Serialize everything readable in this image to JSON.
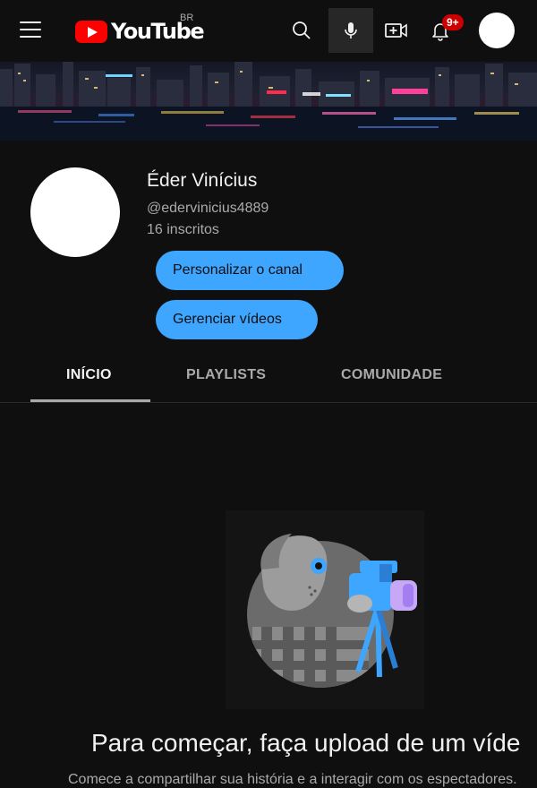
{
  "header": {
    "logo_text": "YouTube",
    "region": "BR",
    "notifications_badge": "9+",
    "icons": [
      "menu-icon",
      "search-icon",
      "mic-icon",
      "create-video-icon",
      "bell-icon"
    ]
  },
  "channel": {
    "name": "Éder Vinícius",
    "handle": "@edervinicius4889",
    "subscribers": "16 inscritos",
    "customize_label": "Personalizar o canal",
    "manage_label": "Gerenciar vídeos"
  },
  "tabs": [
    {
      "label": "INÍCIO",
      "active": true
    },
    {
      "label": "PLAYLISTS",
      "active": false
    },
    {
      "label": "COMUNIDADE",
      "active": false
    }
  ],
  "empty_state": {
    "title": "Para começar, faça upload de um víde",
    "subtitle": "Comece a compartilhar sua história e a interagir com os espectadores."
  },
  "colors": {
    "background": "#0f0f0f",
    "accent_blue": "#3ea6ff",
    "brand_red": "#ff0000",
    "badge_red": "#cc0000"
  }
}
